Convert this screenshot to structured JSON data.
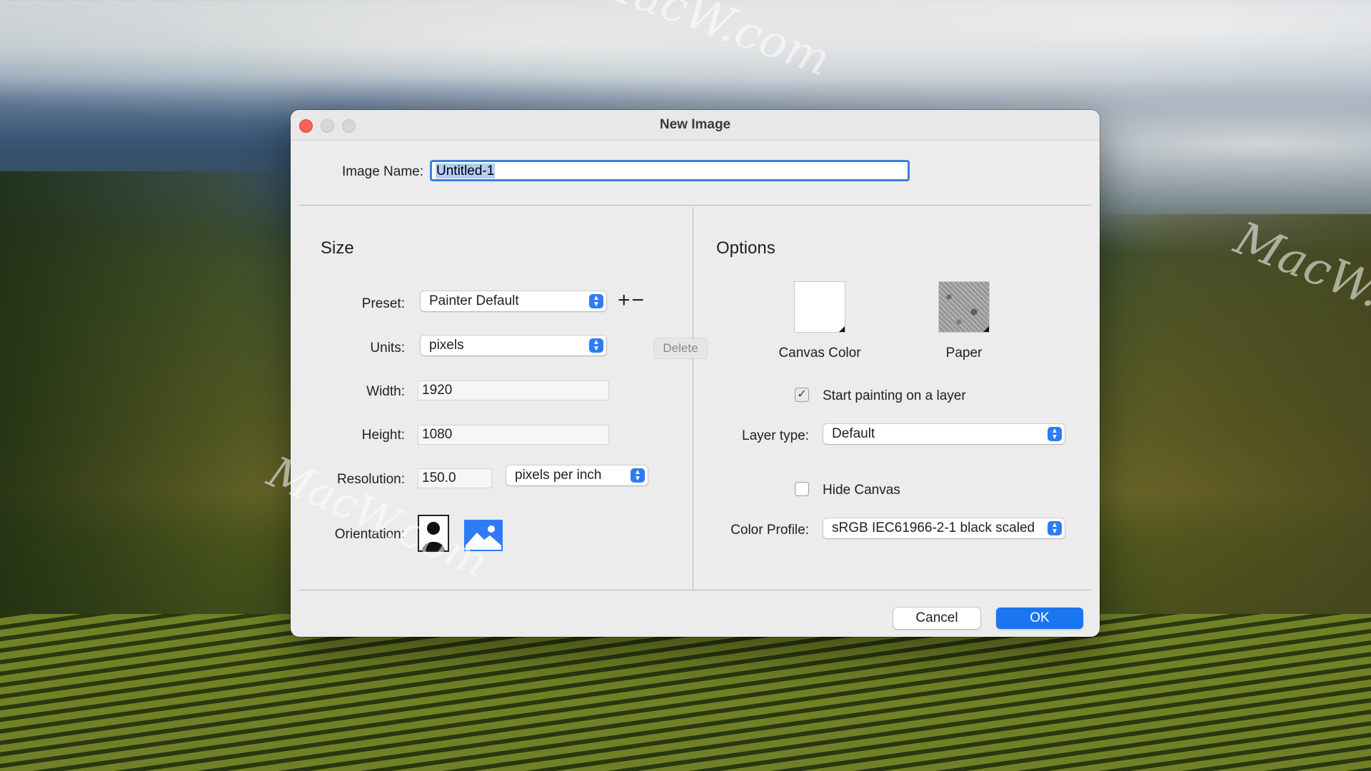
{
  "dialog": {
    "title": "New Image",
    "image_name_label": "Image Name:",
    "image_name_value": "Untitled-1"
  },
  "size": {
    "section_title": "Size",
    "preset_label": "Preset:",
    "preset_value": "Painter Default",
    "plus_minus": "+−",
    "delete_tooltip": "Delete",
    "units_label": "Units:",
    "units_value": "pixels",
    "width_label": "Width:",
    "width_value": "1920",
    "height_label": "Height:",
    "height_value": "1080",
    "resolution_label": "Resolution:",
    "resolution_value": "150.0",
    "resolution_unit": "pixels per inch",
    "orientation_label": "Orientation:"
  },
  "options": {
    "section_title": "Options",
    "canvas_color_label": "Canvas Color",
    "paper_label": "Paper",
    "start_painting_label": "Start painting on a layer",
    "start_painting_checked": true,
    "layer_type_label": "Layer type:",
    "layer_type_value": "Default",
    "hide_canvas_label": "Hide Canvas",
    "hide_canvas_checked": false,
    "color_profile_label": "Color Profile:",
    "color_profile_value": "sRGB IEC61966-2-1 black scaled"
  },
  "buttons": {
    "cancel": "Cancel",
    "ok": "OK"
  },
  "watermark": {
    "text": "MacW.com"
  },
  "colors": {
    "accent": "#1a75f0",
    "close": "#fe5f57"
  }
}
